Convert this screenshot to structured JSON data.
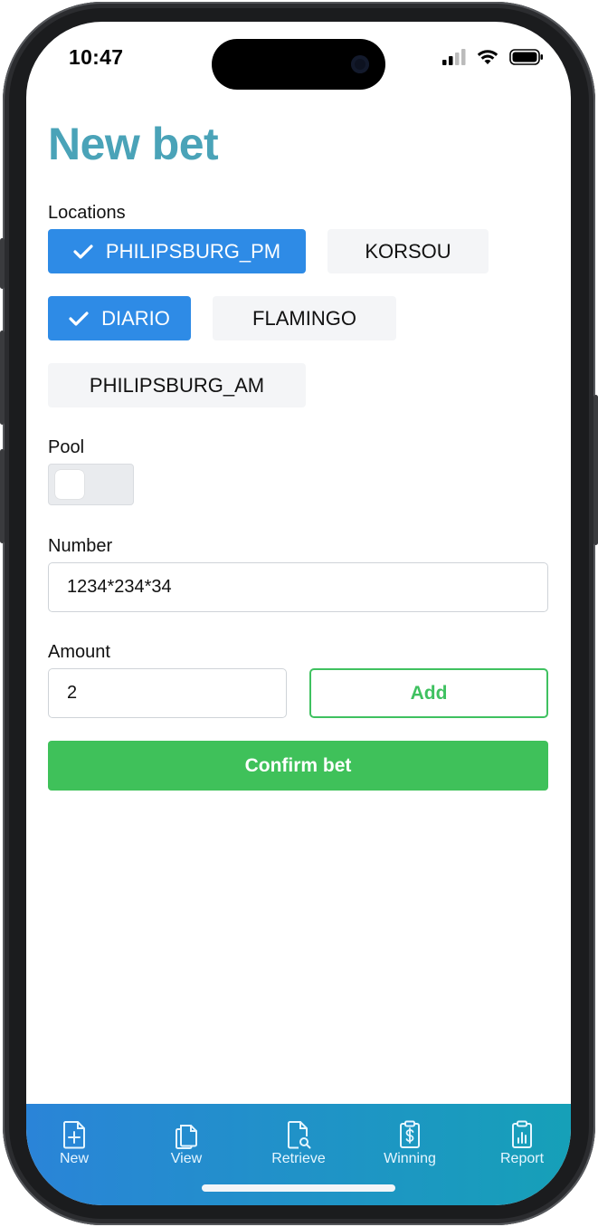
{
  "status_bar": {
    "time": "10:47"
  },
  "page": {
    "title": "New bet"
  },
  "locations": {
    "label": "Locations",
    "options": [
      {
        "name": "PHILIPSBURG_PM",
        "selected": true
      },
      {
        "name": "KORSOU",
        "selected": false
      },
      {
        "name": "DIARIO",
        "selected": true
      },
      {
        "name": "FLAMINGO",
        "selected": false
      },
      {
        "name": "PHILIPSBURG_AM",
        "selected": false
      }
    ]
  },
  "pool": {
    "label": "Pool",
    "enabled": false
  },
  "number": {
    "label": "Number",
    "value": "1234*234*34"
  },
  "amount": {
    "label": "Amount",
    "value": "2"
  },
  "buttons": {
    "add": "Add",
    "confirm": "Confirm bet"
  },
  "tabs": [
    {
      "label": "New",
      "icon": "file-plus-icon"
    },
    {
      "label": "View",
      "icon": "files-icon"
    },
    {
      "label": "Retrieve",
      "icon": "file-search-icon"
    },
    {
      "label": "Winning",
      "icon": "receipt-dollar-icon"
    },
    {
      "label": "Report",
      "icon": "clipboard-chart-icon"
    }
  ],
  "colors": {
    "title": "#4aa3b8",
    "chip_selected": "#2e8be6",
    "chip_unselected": "#f4f5f7",
    "green": "#3fc15a",
    "tabbar_start": "#2a84d8",
    "tabbar_end": "#16a0b8"
  }
}
